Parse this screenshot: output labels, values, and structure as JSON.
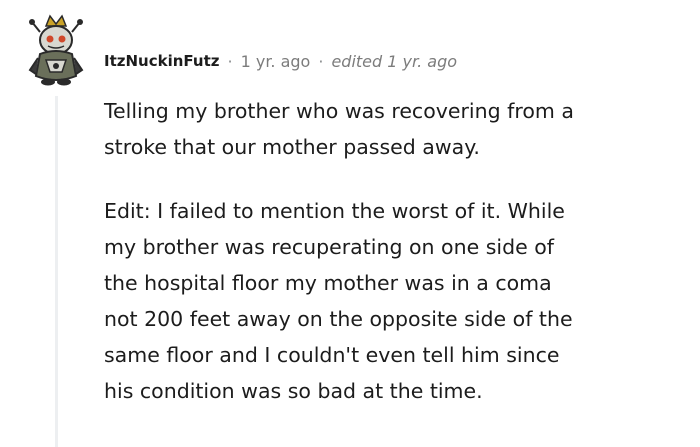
{
  "comment": {
    "author": "ItzNuckinFutz",
    "separator": "·",
    "time_ago": "1 yr. ago",
    "edited_label": "edited 1 yr. ago",
    "paragraphs": [
      {
        "lines": [
          "Telling my brother who was recovering from a",
          "stroke that our mother passed away."
        ]
      },
      {
        "lines": [
          "Edit: I failed to mention the worst of it. While",
          "my brother was recuperating on one side of",
          "the hospital floor my mother was in a coma",
          "not 200 feet away on the opposite side of the",
          "same floor and I couldn't even tell him since",
          "his condition was so bad at the time."
        ]
      }
    ]
  },
  "icons": {
    "avatar": "snoo-avatar-icon"
  },
  "colors": {
    "text": "#1c1c1c",
    "meta": "#7c7c7c",
    "thread_line": "#edeff1"
  }
}
